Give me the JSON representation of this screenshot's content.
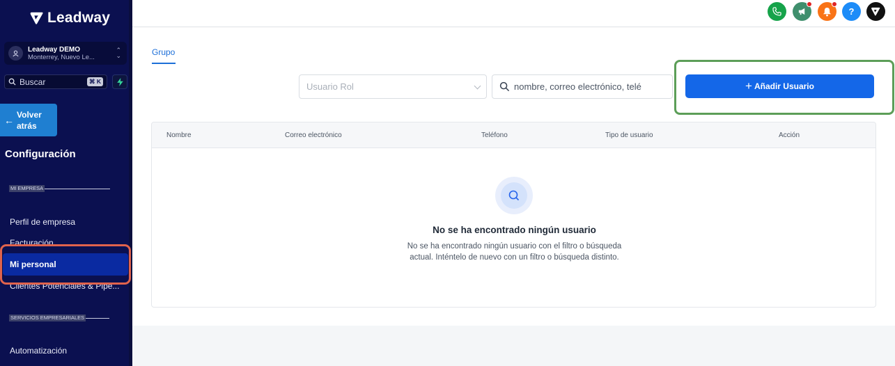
{
  "app": {
    "logo_text": "Leadway"
  },
  "account": {
    "name": "Leadway DEMO",
    "location": "Monterrey, Nuevo Le..."
  },
  "sidebar": {
    "search_label": "Buscar",
    "search_shortcut": "⌘ K",
    "back_label": "Volver atrás",
    "title": "Configuración",
    "sections": [
      {
        "label": "MI EMPRESA",
        "items": [
          {
            "label": "Perfil de empresa"
          },
          {
            "label": "Facturación"
          },
          {
            "label": "Mi personal",
            "active": true
          },
          {
            "label": "Clientes Potenciales & Pipe..."
          }
        ]
      },
      {
        "label": "SERVICIOS EMPRESARIALES",
        "items": [
          {
            "label": "Automatización"
          }
        ]
      }
    ]
  },
  "topbar": {
    "icons": [
      {
        "name": "phone-icon",
        "color": "#16a34a"
      },
      {
        "name": "megaphone-icon",
        "color": "#3f8f6d",
        "badge": true
      },
      {
        "name": "bell-icon",
        "color": "#f97316",
        "badge": true
      },
      {
        "name": "help-icon",
        "color": "#1d8cf8",
        "glyph": "?"
      },
      {
        "name": "leadway-logo-icon",
        "color": "#111111"
      }
    ]
  },
  "main": {
    "tab_label": "Grupo",
    "role_placeholder": "Usuario Rol",
    "search_placeholder": "nombre, correo electrónico, telé",
    "add_button_label": "Añadir Usuario",
    "table": {
      "columns": [
        "Nombre",
        "Correo electrónico",
        "Teléfono",
        "Tipo de usuario",
        "Acción"
      ],
      "rows": []
    },
    "empty_state": {
      "title": "No se ha encontrado ningún usuario",
      "line1": "No se ha encontrado ningún usuario con el filtro o búsqueda",
      "line2": "actual. Inténtelo de nuevo con un filtro o búsqueda distinto."
    }
  }
}
